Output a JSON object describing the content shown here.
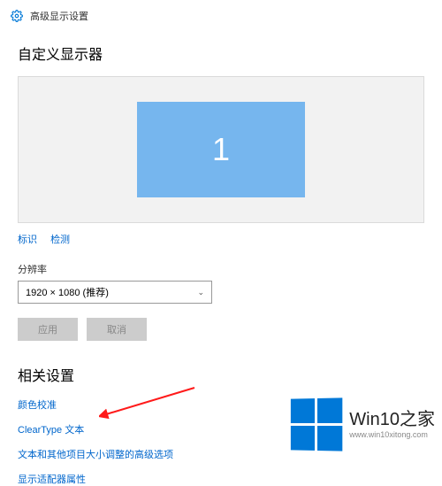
{
  "header": {
    "title": "高级显示设置"
  },
  "sections": {
    "customDisplay": "自定义显示器",
    "related": "相关设置"
  },
  "monitor": {
    "number": "1"
  },
  "links": {
    "identify": "标识",
    "detect": "检测",
    "colorCalibration": "颜色校准",
    "clearType": "ClearType 文本",
    "advancedSizing": "文本和其他项目大小调整的高级选项",
    "adapterProperties": "显示适配器属性"
  },
  "resolution": {
    "label": "分辨率",
    "value": "1920 × 1080 (推荐)"
  },
  "buttons": {
    "apply": "应用",
    "cancel": "取消"
  },
  "watermark": {
    "brand": "Win10",
    "sublabel": "之家",
    "url": "www.win10xitong.com"
  }
}
